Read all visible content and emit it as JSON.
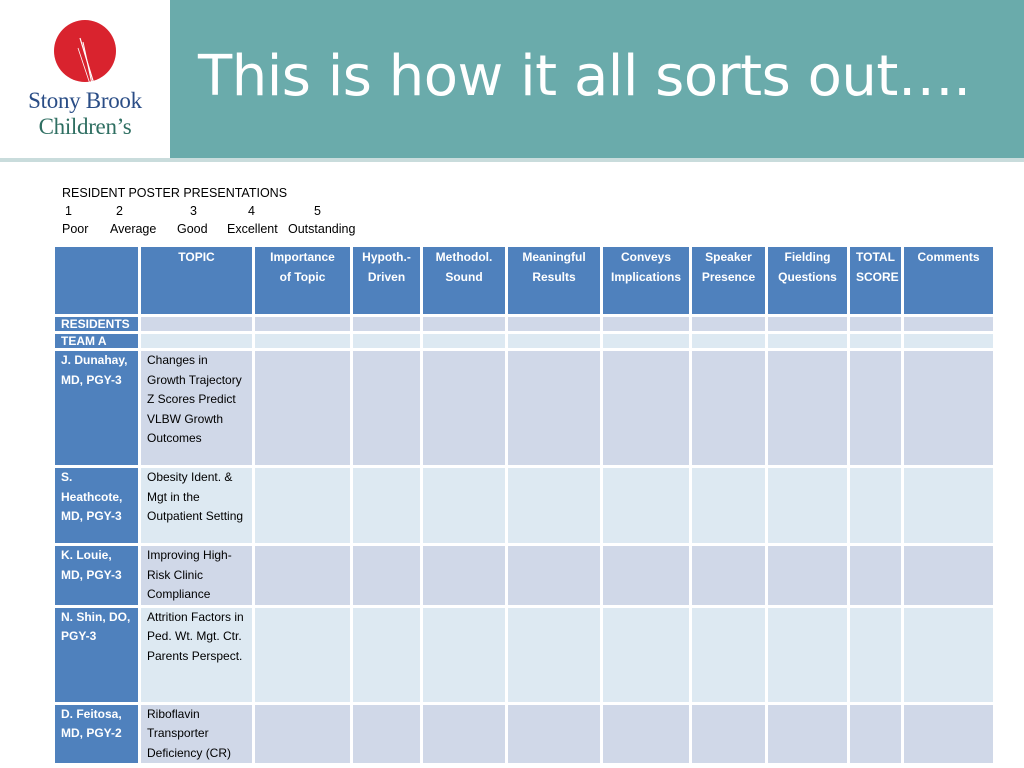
{
  "title": "This is how it all sorts out….",
  "logo": {
    "line1": "Stony Brook",
    "line2": "Children’s"
  },
  "form_title": "RESIDENT POSTER PRESENTATIONS",
  "scale": {
    "numbers": [
      "1",
      "2",
      "3",
      "4",
      "5"
    ],
    "labels": [
      "Poor",
      "Average",
      "Good",
      "Excellent",
      "Outstanding"
    ]
  },
  "table": {
    "headers": [
      {
        "line1": "",
        "line2": ""
      },
      {
        "line1": "TOPIC",
        "line2": ""
      },
      {
        "line1": "Importance",
        "line2": "of Topic"
      },
      {
        "line1": "Hypoth.-",
        "line2": "Driven"
      },
      {
        "line1": "Methodol.",
        "line2": "Sound"
      },
      {
        "line1": "Meaningful",
        "line2": "Results"
      },
      {
        "line1": "Conveys",
        "line2": "Implications"
      },
      {
        "line1": "Speaker",
        "line2": "Presence"
      },
      {
        "line1": "Fielding",
        "line2": "Questions"
      },
      {
        "line1": "TOTAL",
        "line2": "SCORE"
      },
      {
        "line1": "Comments",
        "line2": ""
      }
    ],
    "section_labels": [
      "RESIDENTS",
      "TEAM A"
    ],
    "rows": [
      {
        "name": "J. Dunahay, MD, PGY-3",
        "topic": "Changes in Growth Trajectory Z Scores Predict VLBW Growth Outcomes"
      },
      {
        "name": "S. Heathcote, MD, PGY-3",
        "topic": "Obesity Ident. & Mgt in the Outpatient Setting"
      },
      {
        "name": "K. Louie, MD, PGY-3",
        "topic": "Improving High-Risk Clinic Compliance"
      },
      {
        "name": "N. Shin, DO, PGY-3",
        "topic": "Attrition Factors in Ped. Wt. Mgt. Ctr. Parents Perspect."
      },
      {
        "name": "D. Feitosa, MD, PGY-2",
        "topic": "Riboflavin Transporter Deficiency (CR)"
      }
    ]
  },
  "colors": {
    "title_bar": "#6aabab",
    "header_cell": "#4f81bd",
    "row_band_dark": "#d0d8e8",
    "row_band_light": "#dde9f2",
    "logo_red": "#d9232e"
  }
}
